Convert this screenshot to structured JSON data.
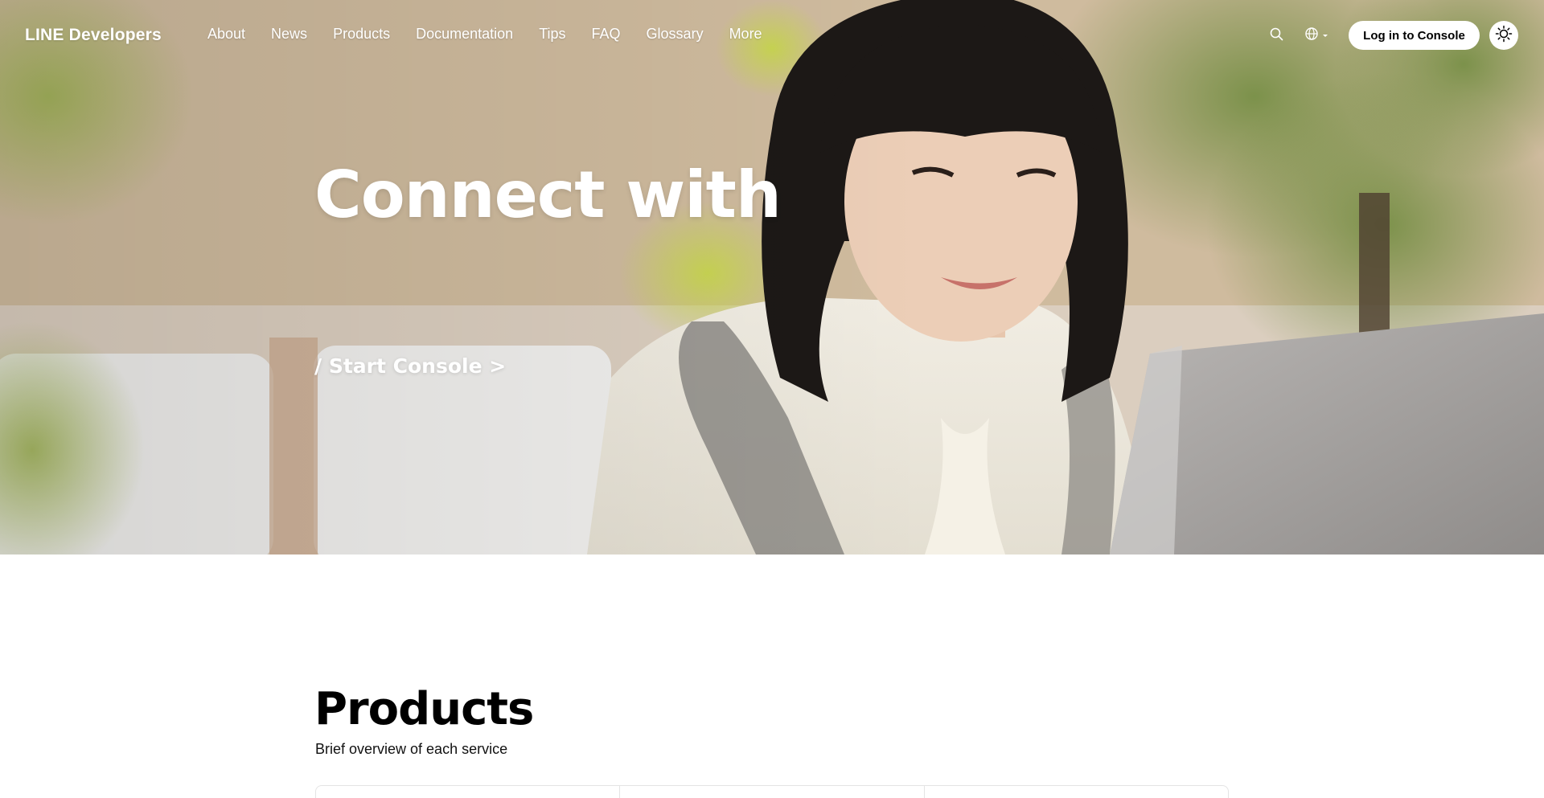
{
  "brand": {
    "name": "LINE Developers"
  },
  "nav": {
    "items": [
      {
        "label": "About"
      },
      {
        "label": "News"
      },
      {
        "label": "Products"
      },
      {
        "label": "Documentation"
      },
      {
        "label": "Tips"
      },
      {
        "label": "FAQ"
      },
      {
        "label": "Glossary"
      },
      {
        "label": "More"
      }
    ],
    "search_icon": "search-icon",
    "language_icon": "globe-icon",
    "login_label": "Log in to Console",
    "theme_icon": "sun-icon"
  },
  "hero": {
    "title": "Connect with",
    "cta": "/ Start Console >"
  },
  "products": {
    "title": "Products",
    "subtitle": "Brief overview of each service"
  },
  "colors": {
    "text_on_hero": "#ffffff",
    "button_bg": "#ffffff",
    "heading": "#000000"
  }
}
